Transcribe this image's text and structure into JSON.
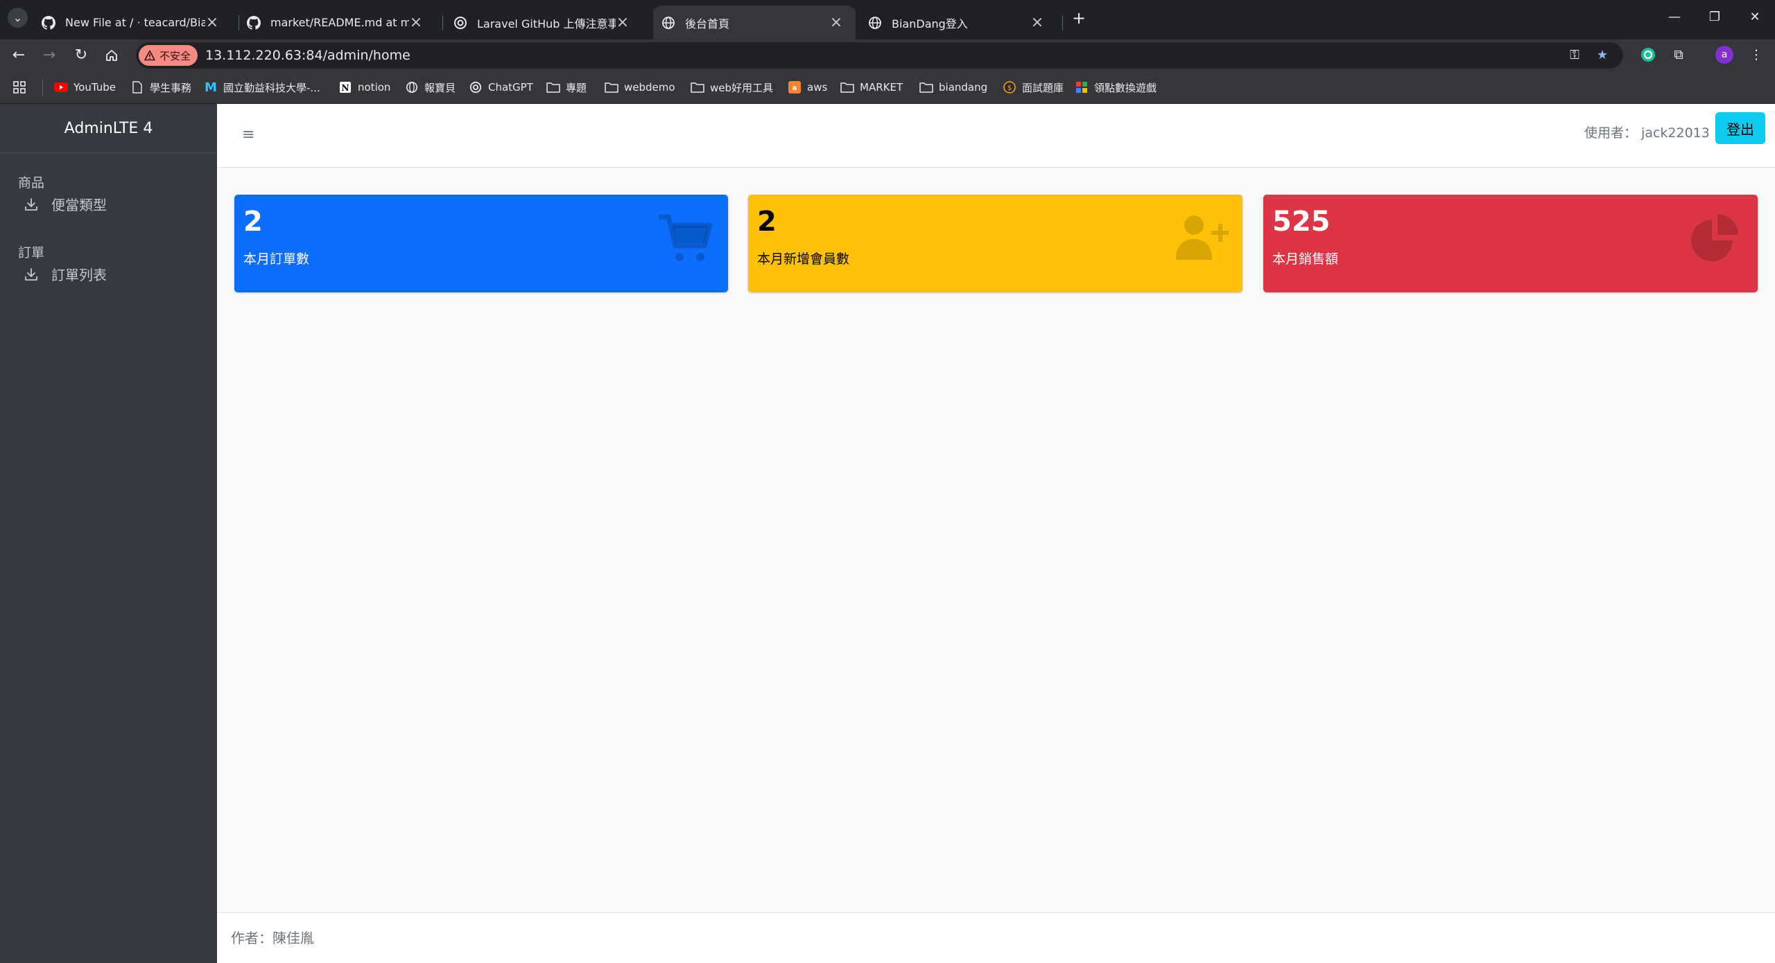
{
  "browser": {
    "tabs": [
      {
        "title": "New File at / · teacard/Bianda",
        "icon": "github-icon"
      },
      {
        "title": "market/README.md at main",
        "icon": "github-icon"
      },
      {
        "title": "Laravel GitHub 上傳注意事項",
        "icon": "openai-icon"
      },
      {
        "title": "後台首頁",
        "icon": "globe-icon",
        "active": true
      },
      {
        "title": "BianDang登入",
        "icon": "globe-icon"
      }
    ],
    "security_label": "不安全",
    "url": "13.112.220.63:84/admin/home",
    "profile_initial": "a",
    "bookmarks": [
      {
        "label": "YouTube",
        "icon": "youtube-icon"
      },
      {
        "label": "學生事務",
        "icon": "page-icon"
      },
      {
        "label": "國立勤益科技大學-...",
        "icon": "m-logo-icon"
      },
      {
        "label": "notion",
        "icon": "notion-icon"
      },
      {
        "label": "報寶貝",
        "icon": "globe-icon"
      },
      {
        "label": "ChatGPT",
        "icon": "openai-icon"
      },
      {
        "label": "專題",
        "icon": "folder-icon"
      },
      {
        "label": "webdemo",
        "icon": "folder-icon"
      },
      {
        "label": "web好用工具",
        "icon": "folder-icon"
      },
      {
        "label": "aws",
        "icon": "aws-icon"
      },
      {
        "label": "MARKET",
        "icon": "folder-icon"
      },
      {
        "label": "biandang",
        "icon": "folder-icon"
      },
      {
        "label": "面試題庫",
        "icon": "hacker-icon"
      },
      {
        "label": "領點數換遊戲",
        "icon": "game-icon"
      }
    ]
  },
  "sidebar": {
    "brand": "AdminLTE 4",
    "sections": [
      {
        "header": "商品",
        "items": [
          {
            "label": "便當類型",
            "icon": "download-icon"
          }
        ]
      },
      {
        "header": "訂單",
        "items": [
          {
            "label": "訂單列表",
            "icon": "download-icon"
          }
        ]
      }
    ]
  },
  "topnav": {
    "user_label": "使用者： jack22013",
    "logout_label": "登出"
  },
  "stats": [
    {
      "value": "2",
      "label": "本月訂單數",
      "color": "#0d6efd",
      "icon": "shopping-cart-icon"
    },
    {
      "value": "2",
      "label": "本月新增會員數",
      "color": "#ffc107",
      "icon": "user-plus-icon"
    },
    {
      "value": "525",
      "label": "本月銷售額",
      "color": "#dc3545",
      "icon": "pie-chart-icon"
    }
  ],
  "footer": {
    "text": "作者：陳佳胤"
  }
}
